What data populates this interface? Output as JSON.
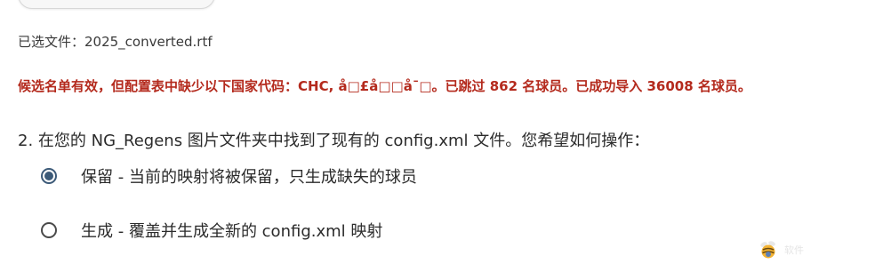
{
  "selected_file": {
    "text": "已选文件：2025_converted.rtf"
  },
  "warning": {
    "text": "候选名单有效，但配置表中缺少以下国家代码：CHC, å□£å□□å¯□。已跳过 862 名球员。已成功导入 36008 名球员。"
  },
  "question": {
    "text": "2. 在您的 NG_Regens 图片文件夹中找到了现有的 config.xml 文件。您希望如何操作："
  },
  "options": [
    {
      "label": "保留 - 当前的映射将被保留，只生成缺失的球员",
      "checked": true
    },
    {
      "label": "生成 - 覆盖并生成全新的 config.xml 映射",
      "checked": false
    }
  ],
  "watermark": {
    "text": "软件",
    "icon": "bee-logo-icon"
  },
  "colors": {
    "warning": "#b42a1d",
    "radio_accent": "#3c5a78",
    "text": "#2b2b2b"
  }
}
